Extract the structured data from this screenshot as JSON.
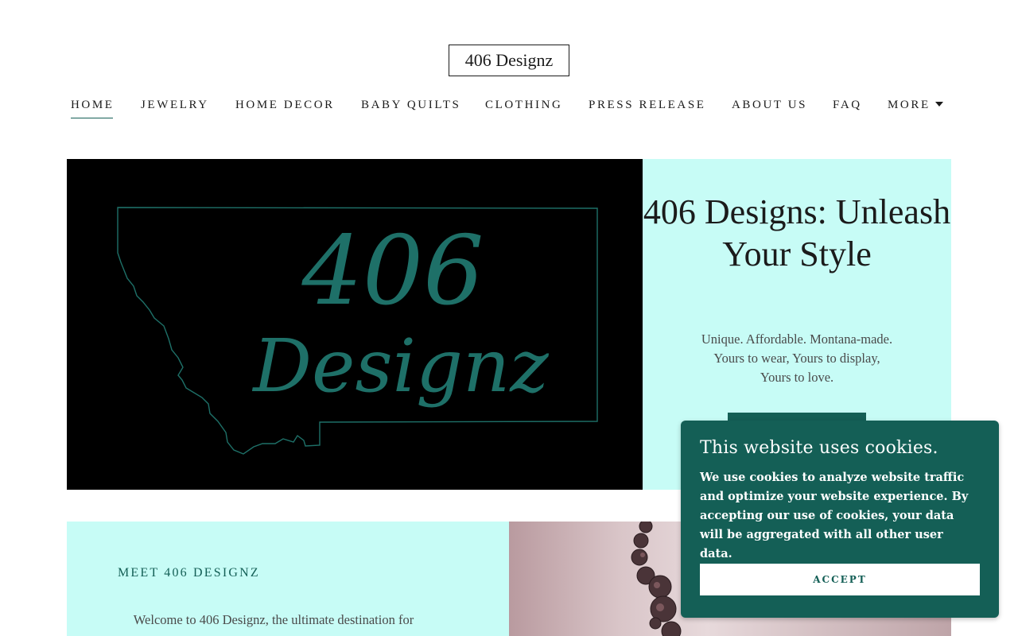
{
  "site": {
    "logo_text": "406 Designz"
  },
  "nav": {
    "items": [
      {
        "label": "HOME",
        "active": true
      },
      {
        "label": "JEWELRY"
      },
      {
        "label": "HOME DECOR"
      },
      {
        "label": "BABY QUILTS"
      },
      {
        "label": "CLOTHING"
      },
      {
        "label": "PRESS RELEASE"
      },
      {
        "label": "ABOUT US"
      },
      {
        "label": "FAQ"
      },
      {
        "label": "MORE"
      }
    ]
  },
  "hero": {
    "title": "406 Designs: Unleash Your Style",
    "subtitle": "Unique.  Affordable.  Montana-made.\nYours to wear,  Yours to display,\nYours to love.",
    "image_text_top": "406",
    "image_text_bottom": "Designz"
  },
  "about": {
    "heading": "MEET 406 DESIGNZ",
    "text": "Welcome to 406 Designz, the ultimate destination for"
  },
  "cookie_banner": {
    "title": "This website uses cookies.",
    "text": "We use cookies to analyze website traffic and optimize your website experience. By accepting our use of cookies, your data will be aggregated with all other user data.",
    "accept_label": "ACCEPT"
  },
  "colors": {
    "accent": "#145f56",
    "panel_bg": "#c7fcf6",
    "image_text": "#1e7068"
  }
}
